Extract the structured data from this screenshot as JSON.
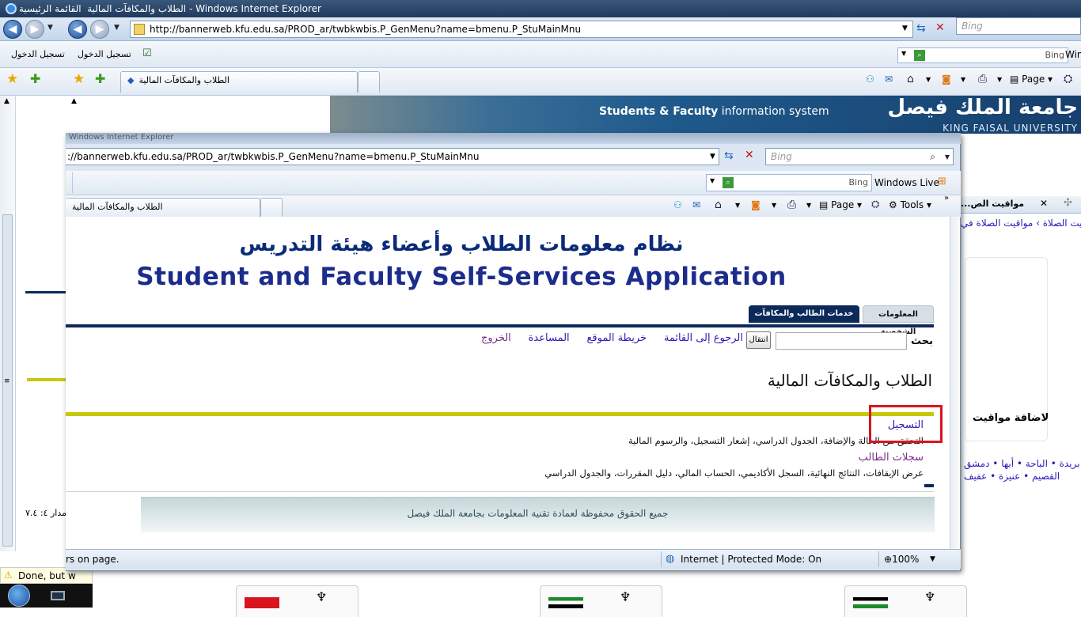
{
  "outer_window": {
    "title": "القائمة الرئيسية ‎ الطلاب والمكافآت المالية - Windows Internet Explorer",
    "address": "http://bannerweb.kfu.edu.sa/PROD_ar/twbkwbis.P_GenMenu?name=bmenu.P_StuMainMnu",
    "search_placeholder": "Bing",
    "search_right_placeholder": "Bing",
    "links_bar": [
      "تسجيل الدخول",
      "تسجيل الدخول"
    ],
    "tab_label": "الطلاب والمكافآت المالية",
    "page_menu": "Page",
    "right_win_label": "Win",
    "status_text": "Done, but w",
    "banner": {
      "students_faculty": "Students & Faculty",
      "info_system": "information system",
      "arabic": "جامعة الملك فيصل",
      "english": "KING FAISAL UNIVERSITY"
    },
    "right_page": {
      "tab_title": "...مواقيت الص",
      "breadcrumb": "مواقيت الصلاة › مواقيت الصلاة في",
      "heading": "لاضافة مواقيت",
      "cities_line1": [
        "دمشق",
        "أبها",
        "الباحة",
        "بريدة"
      ],
      "cities_line2": [
        "عفيف",
        "عنيزة",
        "القصيم"
      ]
    },
    "left_text": "مدار ٤: ٧.٤"
  },
  "inner_window": {
    "address": "://bannerweb.kfu.edu.sa/PROD_ar/twbkwbis.P_GenMenu?name=bmenu.P_StuMainMnu",
    "search_placeholder": "Bing",
    "live_search_placeholder": "Bing",
    "windows_live": "Windows Live",
    "tab_label": "الطلاب والمكافآت المالية",
    "page_menu": "Page",
    "tools_menu": "Tools",
    "status_left": "rs on page.",
    "status_zone": "Internet | Protected Mode: On",
    "zoom": "100%",
    "ghost_title": "Windows Internet Explorer"
  },
  "page": {
    "title_ar": "نظام معلومات الطلاب وأعضاء هيئة التدريس",
    "title_en": "Student and Faculty Self-Services Application",
    "tabs": [
      "المعلومات الشخصية",
      "خدمات الطالب والمكافآت المالية"
    ],
    "search_label": "بحث",
    "go_button": "انتقال",
    "nav_links": [
      "الرجوع إلى القائمة",
      "خريطة الموقع",
      "المساعدة",
      "الخروج"
    ],
    "section_title": "الطلاب والمكافآت المالية",
    "menu": [
      {
        "label": "التسجيل",
        "desc": "التحقق من الحالة والإضافة، الجدول الدراسي، إشعار التسجيل، والرسوم المالية"
      },
      {
        "label": "سجلات الطالب",
        "desc": "عرض الإيقافات، النتائج النهائية، السجل الأكاديمي، الحساب المالي، دليل المقررات، والجدول الدراسي"
      }
    ],
    "footer": "جميع الحقوق محفوظة لعمادة تقنية المعلومات بجامعة الملك فيصل"
  },
  "colors": {
    "highlight_box": "#d8141e",
    "divider_yellow": "#c8c80a",
    "nav_blue": "#0b2a5a"
  }
}
